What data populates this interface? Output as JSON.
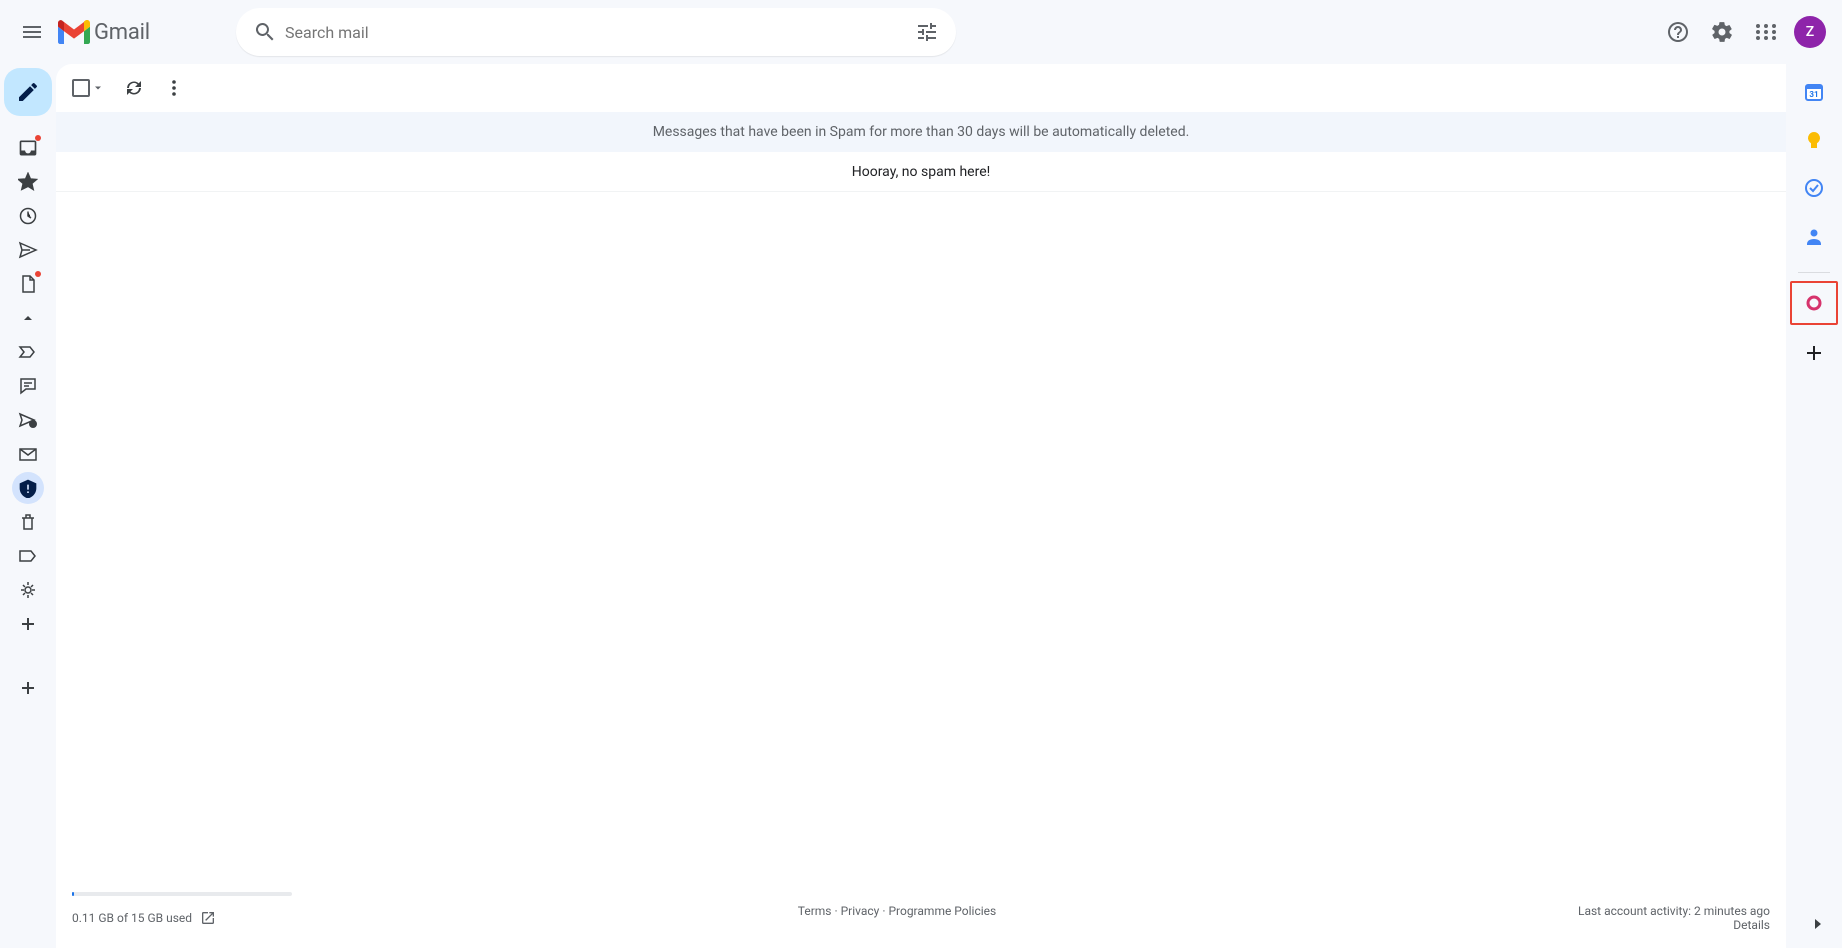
{
  "header": {
    "app_name": "Gmail",
    "search_placeholder": "Search mail",
    "avatar_letter": "Z"
  },
  "banner_text": "Messages that have been in Spam for more than 30 days will be automatically deleted.",
  "empty_text": "Hooray, no spam here!",
  "footer": {
    "storage": "0.11 GB of 15 GB used",
    "terms": "Terms",
    "privacy": "Privacy",
    "policies": "Programme Policies",
    "activity": "Last account activity: 2 minutes ago",
    "details": "Details"
  }
}
